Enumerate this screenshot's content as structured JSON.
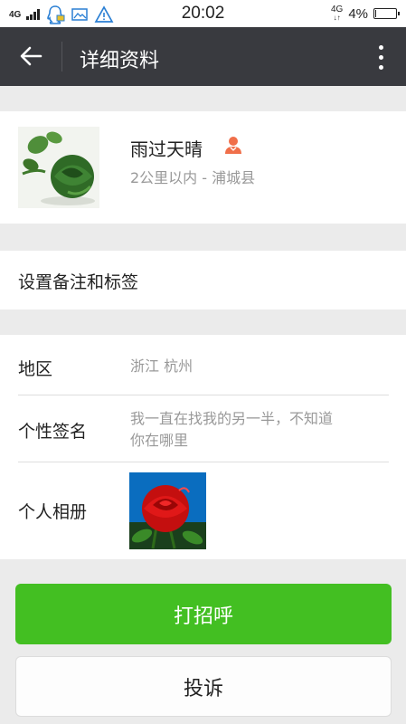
{
  "status_bar": {
    "network_left": "4G",
    "time": "20:02",
    "network_right": "4G",
    "battery": "4%",
    "battery_level": 0.04,
    "icons": [
      "signal-icon",
      "qq-icon",
      "gallery-icon",
      "warning-icon"
    ]
  },
  "header": {
    "title": "详细资料",
    "back_icon": "arrow-left-icon",
    "more_icon": "more-vertical-icon"
  },
  "profile": {
    "name": "雨过天晴",
    "distance": "2公里以内 - 浦城县",
    "gender_icon": "person-icon"
  },
  "remarks": {
    "label": "设置备注和标签"
  },
  "info": {
    "region_label": "地区",
    "region_value": "浙江  杭州",
    "signature_label": "个性签名",
    "signature_line1": "我一直在找我的另一半，不知道",
    "signature_line2": "你在哪里",
    "album_label": "个人相册"
  },
  "actions": {
    "primary_label": "打招呼",
    "secondary_label": "投诉"
  },
  "colors": {
    "header_bg": "#393a3f",
    "primary_green": "#43bf22",
    "page_bg": "#ebebeb",
    "secondary_text": "#999999",
    "gender_icon": "#f06f4a"
  }
}
